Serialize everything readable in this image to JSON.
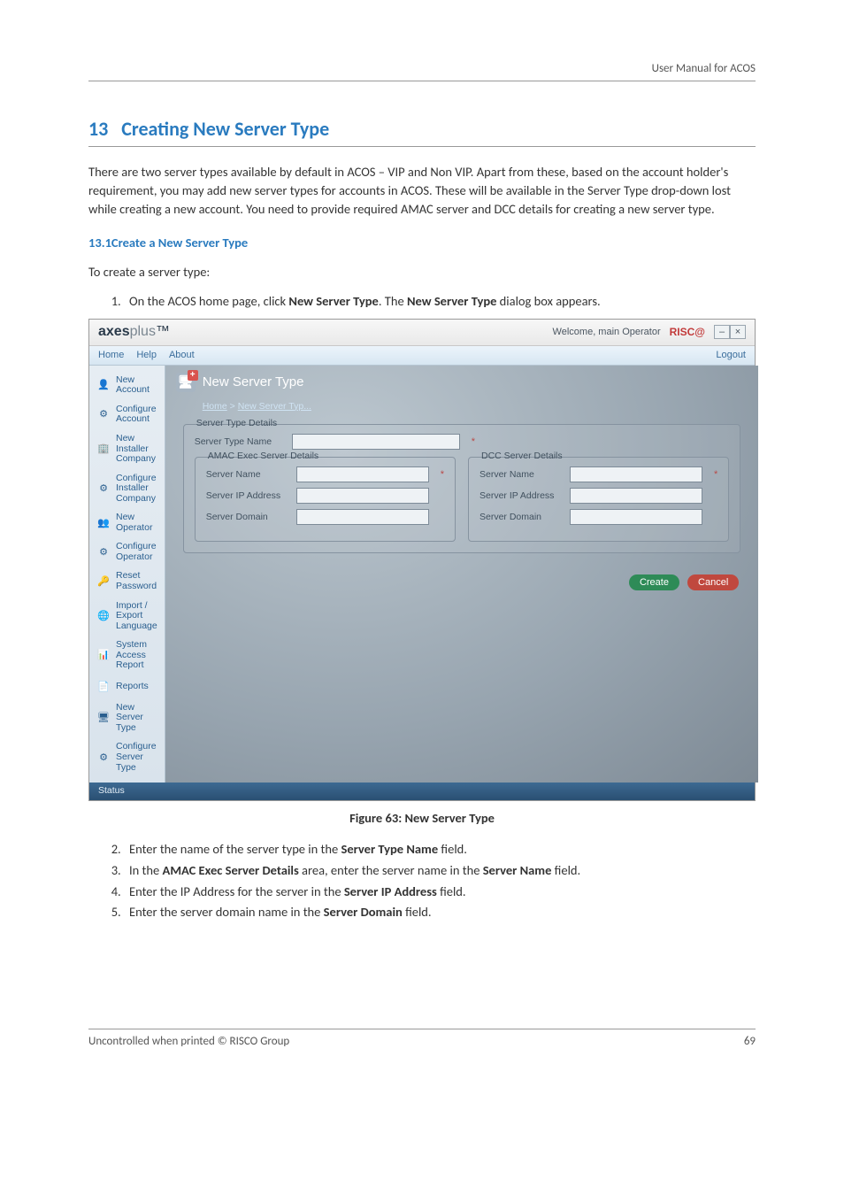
{
  "doc": {
    "header_right": "User Manual for ACOS",
    "section_number": "13",
    "section_title": "Creating New Server Type",
    "intro_paragraph": "There are two server types available by default in ACOS – VIP and Non VIP. Apart from these, based on the account holder's requirement, you may add new server types for accounts in ACOS. These will be available in the Server Type drop-down lost while creating a new account. You need to provide required AMAC server and DCC details for creating a new server type.",
    "subheading": "13.1Create a New Server Type",
    "pre_list_line": "To create a server type:",
    "figure_caption": "Figure 63: New Server Type",
    "footer_left": "Uncontrolled when printed © RISCO Group",
    "footer_right": "69"
  },
  "steps_top": [
    {
      "prefix": "On the ACOS home page, click ",
      "bold1": "New Server Type",
      "mid": ". The ",
      "bold2": "New Server Type",
      "suffix": " dialog box appears."
    }
  ],
  "steps_bottom": [
    {
      "prefix": "Enter the name of the server type in the ",
      "bold1": "Server Type Name",
      "suffix": " field."
    },
    {
      "prefix": "In the ",
      "bold1": "AMAC Exec Server Details",
      "mid": " area, enter the server name in the ",
      "bold2": "Server Name",
      "suffix": " field."
    },
    {
      "prefix": "Enter the IP Address for the server in the ",
      "bold1": "Server IP Address",
      "suffix": " field."
    },
    {
      "prefix": "Enter the server domain name in the ",
      "bold1": "Server Domain",
      "suffix": " field."
    }
  ],
  "app": {
    "logo_main": "axes",
    "logo_sub": "plus",
    "logo_tm": "™",
    "welcome": "Welcome, main Operator",
    "risco": "RISC@",
    "logout": "Logout",
    "menu": {
      "home": "Home",
      "help": "Help",
      "about": "About"
    },
    "sidebar": [
      {
        "label": "New Account"
      },
      {
        "label": "Configure Account"
      },
      {
        "label": "New Installer Company"
      },
      {
        "label": "Configure Installer Company"
      },
      {
        "label": "New Operator"
      },
      {
        "label": "Configure Operator"
      },
      {
        "label": "Reset Password"
      },
      {
        "label": "Import / Export Language"
      },
      {
        "label": "System Access Report"
      },
      {
        "label": "Reports"
      },
      {
        "label": "New Server Type"
      },
      {
        "label": "Configure Server Type"
      }
    ],
    "panel_title": "New Server Type",
    "breadcrumb_home": "Home",
    "breadcrumb_sep": " > ",
    "breadcrumb_current": "New Server Typ...",
    "fs_outer": "Server Type Details",
    "lbl_server_type_name": "Server Type Name",
    "fs_amac": "AMAC Exec Server Details",
    "fs_dcc": "DCC Server Details",
    "lbl_server_name": "Server Name",
    "lbl_ip": "Server IP Address",
    "lbl_domain": "Server Domain",
    "btn_create": "Create",
    "btn_cancel": "Cancel",
    "status": "Status"
  }
}
